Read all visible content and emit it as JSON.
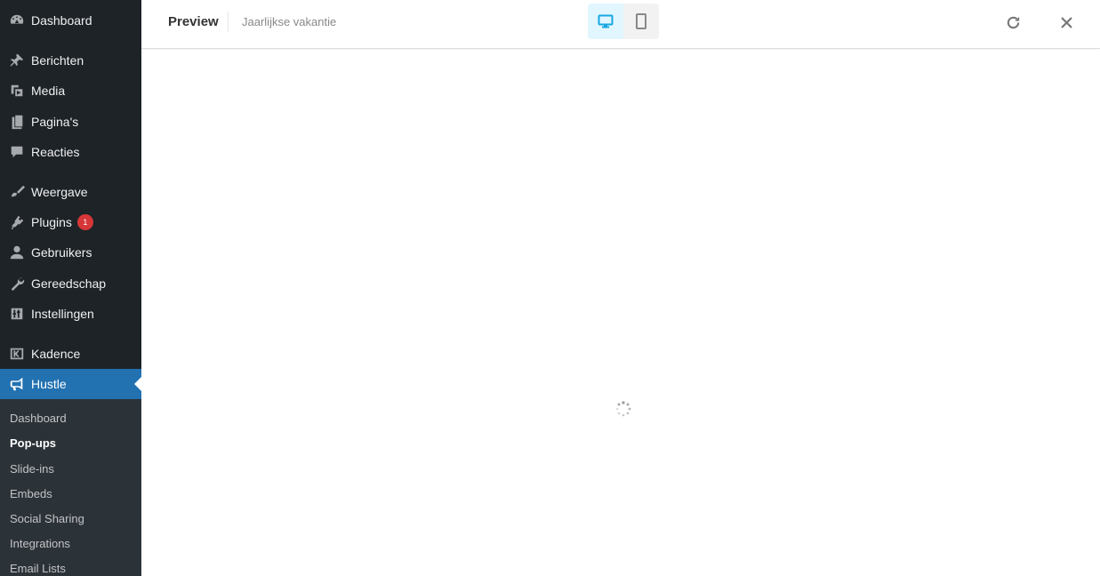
{
  "sidebar": {
    "items": [
      {
        "label": "Dashboard",
        "icon": "dashboard-icon"
      },
      {
        "label": "Berichten",
        "icon": "pin-icon"
      },
      {
        "label": "Media",
        "icon": "media-icon"
      },
      {
        "label": "Pagina's",
        "icon": "pages-icon"
      },
      {
        "label": "Reacties",
        "icon": "comments-icon"
      },
      {
        "label": "Weergave",
        "icon": "brush-icon"
      },
      {
        "label": "Plugins",
        "icon": "plugin-icon",
        "badge": "1"
      },
      {
        "label": "Gebruikers",
        "icon": "user-icon"
      },
      {
        "label": "Gereedschap",
        "icon": "wrench-icon"
      },
      {
        "label": "Instellingen",
        "icon": "settings-icon"
      },
      {
        "label": "Kadence",
        "icon": "kadence-icon"
      },
      {
        "label": "Hustle",
        "icon": "megaphone-icon",
        "active": true
      }
    ],
    "submenu": [
      {
        "label": "Dashboard"
      },
      {
        "label": "Pop-ups",
        "current": true
      },
      {
        "label": "Slide-ins"
      },
      {
        "label": "Embeds"
      },
      {
        "label": "Social Sharing"
      },
      {
        "label": "Integrations"
      },
      {
        "label": "Email Lists"
      }
    ]
  },
  "preview": {
    "title": "Preview",
    "module_name": "Jaarlijkse vakantie",
    "devices": [
      {
        "name": "desktop",
        "icon": "desktop-icon",
        "selected": true
      },
      {
        "name": "mobile",
        "icon": "mobile-icon",
        "selected": false
      }
    ],
    "actions": [
      {
        "name": "refresh",
        "icon": "refresh-icon"
      },
      {
        "name": "close",
        "icon": "close-icon"
      }
    ],
    "loading": true
  },
  "colors": {
    "sidebar_bg": "#1d2327",
    "submenu_bg": "#2c3338",
    "active_bg": "#2271b1",
    "badge_bg": "#d63638",
    "device_active_bg": "#e1f6ff",
    "device_active_icon": "#17a8e3"
  }
}
